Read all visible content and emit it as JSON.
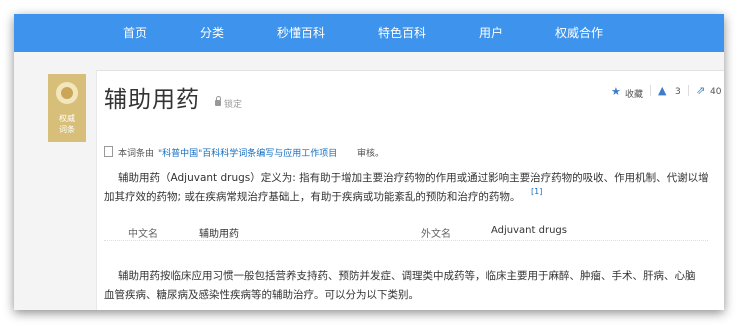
{
  "nav": {
    "items": [
      "首页",
      "分类",
      "秒懂百科",
      "特色百科",
      "用户",
      "权威合作"
    ]
  },
  "badge": {
    "line1": "权威",
    "line2": "词条"
  },
  "entry": {
    "title": "辅助用药",
    "lock_label": "锁定",
    "actions": {
      "favorite_label": "收藏",
      "like_count": "3",
      "share_count": "40"
    },
    "credit": {
      "prefix": "本词条由",
      "link": "\"科普中国\"百科科学词条编写与应用工作项目",
      "suffix": "审核。"
    },
    "definition": {
      "line1": "辅助用药（Adjuvant drugs）定义为: 指有助于增加主要治疗药物的作用或通过影响主要治疗药物的吸收、作用机制、代谢以增",
      "line2": "加其疗效的药物; 或在疾病常规治疗基础上，有助于疾病或功能紊乱的预防和治疗的药物。",
      "ref": "[1]"
    },
    "basic_info": {
      "cn_name_label": "中文名",
      "cn_name_value": "辅助用药",
      "foreign_name_label": "外文名",
      "foreign_name_value": "Adjuvant drugs"
    },
    "body": {
      "line1": "辅助用药按临床应用习惯一般包括营养支持药、预防并发症、调理类中成药等，临床主要用于麻醉、肿瘤、手术、肝病、心脑",
      "line2": "血管疾病、糖尿病及感染性疾病等的辅助治疗。可以分为以下类别。"
    }
  },
  "colors": {
    "nav_bg": "#3e94ec",
    "badge_bg": "#d8bf79",
    "link": "#136ec2"
  }
}
